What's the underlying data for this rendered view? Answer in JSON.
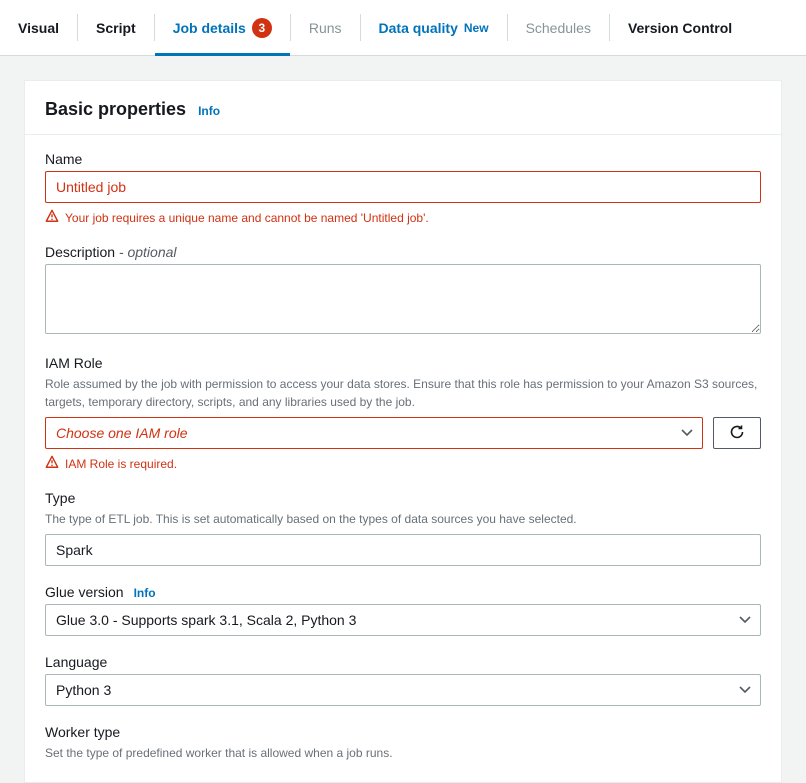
{
  "tabs": {
    "visual": "Visual",
    "script": "Script",
    "job_details": "Job details",
    "job_details_badge": "3",
    "runs": "Runs",
    "data_quality": "Data quality",
    "data_quality_new": "New",
    "schedules": "Schedules",
    "version_control": "Version Control"
  },
  "panel": {
    "title": "Basic properties",
    "info": "Info"
  },
  "fields": {
    "name": {
      "label": "Name",
      "value": "Untitled job",
      "error": "Your job requires a unique name and cannot be named 'Untitled job'."
    },
    "description": {
      "label": "Description",
      "optional": "- optional",
      "value": ""
    },
    "iam_role": {
      "label": "IAM Role",
      "help": "Role assumed by the job with permission to access your data stores. Ensure that this role has permission to your Amazon S3 sources, targets, temporary directory, scripts, and any libraries used by the job.",
      "placeholder": "Choose one IAM role",
      "error": "IAM Role is required."
    },
    "type": {
      "label": "Type",
      "help": "The type of ETL job. This is set automatically based on the types of data sources you have selected.",
      "value": "Spark"
    },
    "glue_version": {
      "label": "Glue version",
      "info": "Info",
      "value": "Glue 3.0 - Supports spark 3.1, Scala 2, Python 3"
    },
    "language": {
      "label": "Language",
      "value": "Python 3"
    },
    "worker_type": {
      "label": "Worker type",
      "help": "Set the type of predefined worker that is allowed when a job runs."
    }
  }
}
